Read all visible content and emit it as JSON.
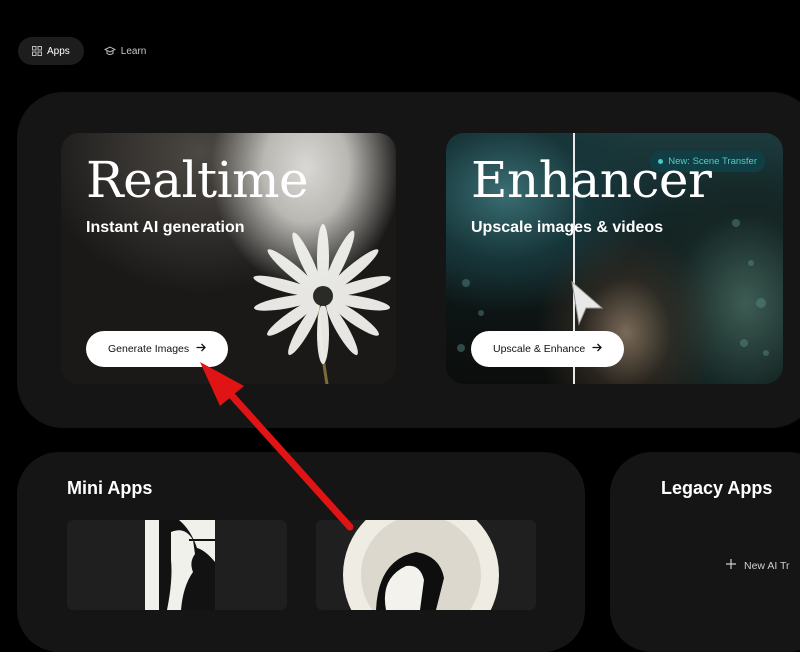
{
  "nav": {
    "tabs": [
      {
        "label": "Apps",
        "icon": "grid-icon",
        "active": true
      },
      {
        "label": "Learn",
        "icon": "graduation-cap-icon",
        "active": false
      }
    ]
  },
  "hero": {
    "realtime": {
      "title": "Realtime",
      "subtitle": "Instant AI generation",
      "button_label": "Generate Images",
      "button_icon": "arrow-right-icon"
    },
    "enhancer": {
      "title": "Enhancer",
      "subtitle": "Upscale images & videos",
      "button_label": "Upscale & Enhance",
      "button_icon": "arrow-right-icon",
      "badge": "New: Scene Transfer"
    }
  },
  "mini_apps": {
    "title": "Mini Apps"
  },
  "legacy_apps": {
    "title": "Legacy Apps",
    "new_item_label": "New AI Tr"
  },
  "colors": {
    "background": "#000000",
    "panel": "#151515",
    "badge_bg": "#0f3f44",
    "badge_text": "#55c9c9",
    "annotation_arrow": "#e01414"
  }
}
